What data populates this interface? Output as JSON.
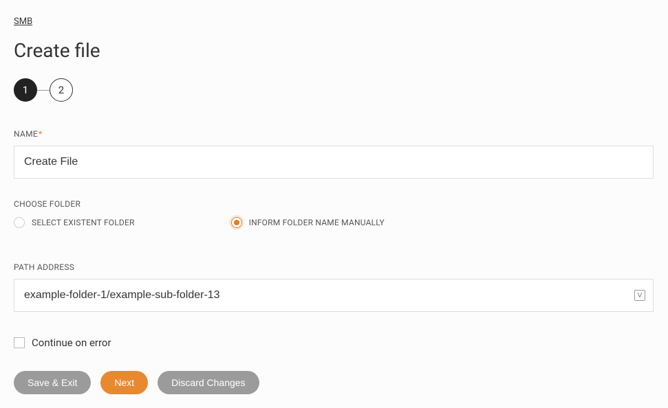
{
  "breadcrumb": "SMB",
  "page_title": "Create file",
  "stepper": {
    "steps": [
      "1",
      "2"
    ],
    "active_index": 0
  },
  "name_field": {
    "label": "NAME",
    "required_mark": "*",
    "value": "Create File"
  },
  "folder_section": {
    "label": "CHOOSE FOLDER",
    "options": [
      {
        "label": "SELECT EXISTENT FOLDER",
        "selected": false
      },
      {
        "label": "INFORM FOLDER NAME MANUALLY",
        "selected": true
      }
    ]
  },
  "path_field": {
    "label": "PATH ADDRESS",
    "value": "example-folder-1/example-sub-folder-13",
    "icon_glyph": "V"
  },
  "continue_on_error": {
    "label": "Continue on error",
    "checked": false
  },
  "buttons": {
    "save_exit": "Save & Exit",
    "next": "Next",
    "discard": "Discard Changes"
  }
}
